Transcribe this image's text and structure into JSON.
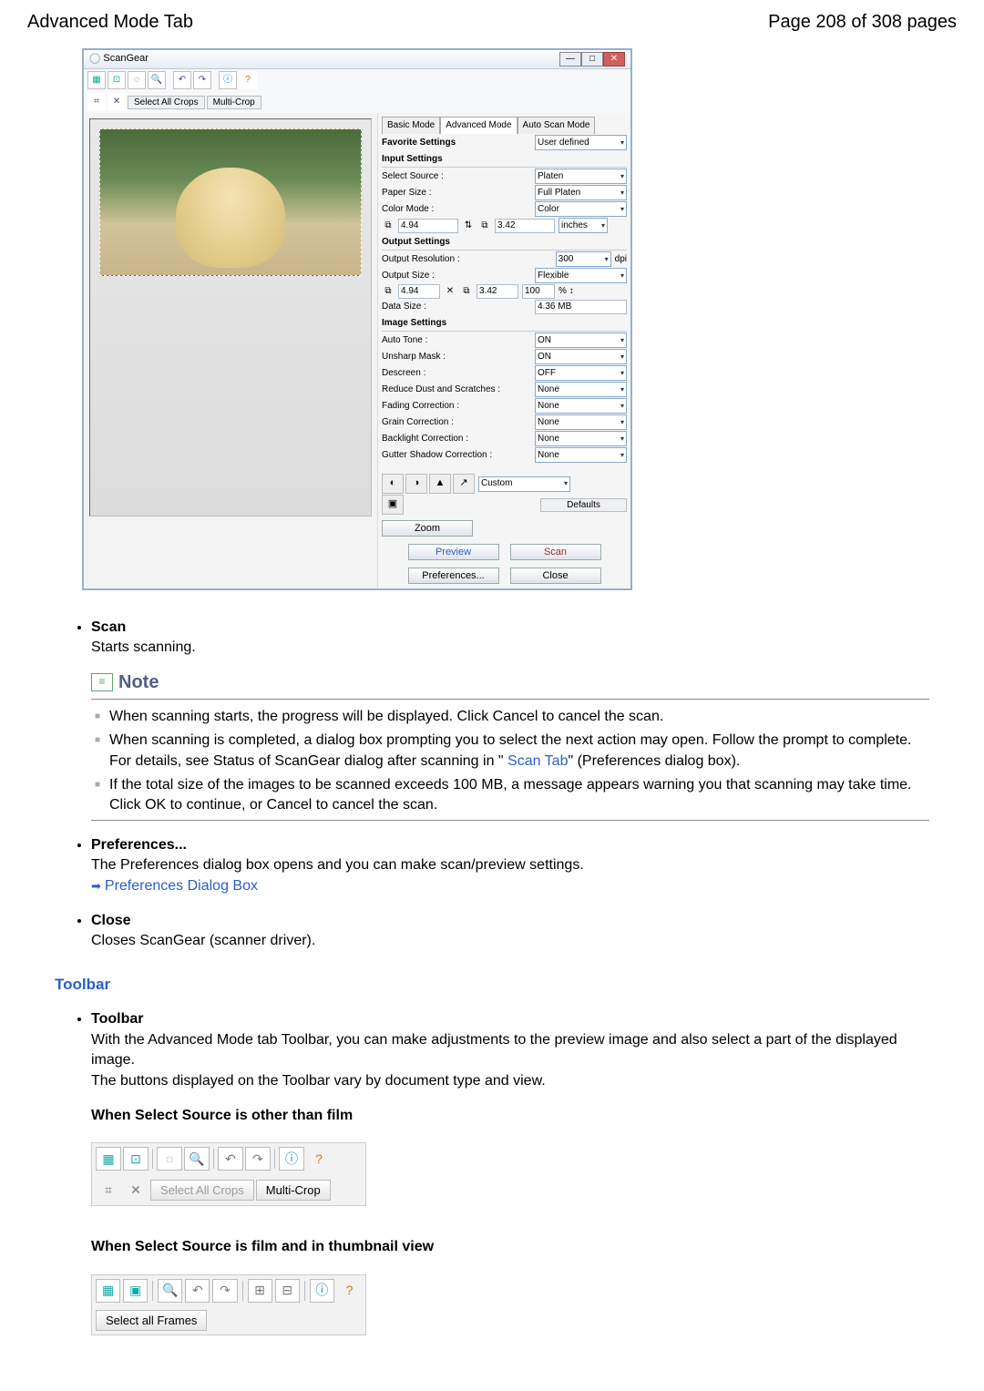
{
  "header": {
    "title": "Advanced Mode Tab",
    "page_info": "Page 208 of 308 pages"
  },
  "window": {
    "title": "ScanGear",
    "toolbar2": {
      "select_all_crops": "Select All Crops",
      "multi_crop": "Multi-Crop"
    },
    "tabs": {
      "basic": "Basic Mode",
      "advanced": "Advanced Mode",
      "auto": "Auto Scan Mode"
    },
    "favorite": {
      "label": "Favorite Settings",
      "value": "User defined"
    },
    "input": {
      "title": "Input Settings",
      "select_source_label": "Select Source :",
      "select_source_value": "Platen",
      "paper_size_label": "Paper Size :",
      "paper_size_value": "Full Platen",
      "color_mode_label": "Color Mode :",
      "color_mode_value": "Color",
      "width": "4.94",
      "height": "3.42",
      "unit": "inches"
    },
    "output": {
      "title": "Output Settings",
      "resolution_label": "Output Resolution :",
      "resolution_value": "300",
      "output_size_label": "Output Size :",
      "output_size_value": "Flexible",
      "width": "4.94",
      "height": "3.42",
      "scale": "100",
      "datasize_label": "Data Size :",
      "datasize_value": "4.36 MB"
    },
    "image": {
      "title": "Image Settings",
      "auto_tone_label": "Auto Tone :",
      "auto_tone_value": "ON",
      "unsharp_label": "Unsharp Mask :",
      "unsharp_value": "ON",
      "descreen_label": "Descreen :",
      "descreen_value": "OFF",
      "dust_label": "Reduce Dust and Scratches :",
      "dust_value": "None",
      "fading_label": "Fading Correction :",
      "fading_value": "None",
      "grain_label": "Grain Correction :",
      "grain_value": "None",
      "backlight_label": "Backlight Correction :",
      "backlight_value": "None",
      "gutter_label": "Gutter Shadow Correction :",
      "gutter_value": "None"
    },
    "adjust": {
      "custom": "Custom",
      "defaults": "Defaults"
    },
    "actions": {
      "zoom": "Zoom",
      "preview": "Preview",
      "scan": "Scan",
      "preferences": "Preferences...",
      "close": "Close"
    }
  },
  "doc": {
    "scan": {
      "title": "Scan",
      "desc": "Starts scanning."
    },
    "note": {
      "heading": "Note",
      "items": [
        "When scanning starts, the progress will be displayed. Click Cancel to cancel the scan.",
        "When scanning is completed, a dialog box prompting you to select the next action may open. Follow the prompt to complete. For details, see Status of ScanGear dialog after scanning in \"",
        "\" (Preferences dialog box).",
        "If the total size of the images to be scanned exceeds 100 MB, a message appears warning you that scanning may take time. Click OK to continue, or Cancel to cancel the scan."
      ],
      "scan_tab_link": "Scan Tab"
    },
    "prefs": {
      "title": "Preferences...",
      "desc": "The Preferences dialog box opens and you can make scan/preview settings.",
      "link": "Preferences Dialog Box"
    },
    "close": {
      "title": "Close",
      "desc": "Closes ScanGear (scanner driver)."
    },
    "toolbar_section": "Toolbar",
    "toolbar_item": {
      "title": "Toolbar",
      "desc1": "With the Advanced Mode tab Toolbar, you can make adjustments to the preview image and also select a part of the displayed image.",
      "desc2": "The buttons displayed on the Toolbar vary by document type and view."
    },
    "illA_title": "When Select Source is other than film",
    "illA": {
      "select_all": "Select All Crops",
      "multi": "Multi-Crop"
    },
    "illB_title": "When Select Source is film and in thumbnail view",
    "illB": {
      "select_all": "Select all Frames"
    }
  }
}
